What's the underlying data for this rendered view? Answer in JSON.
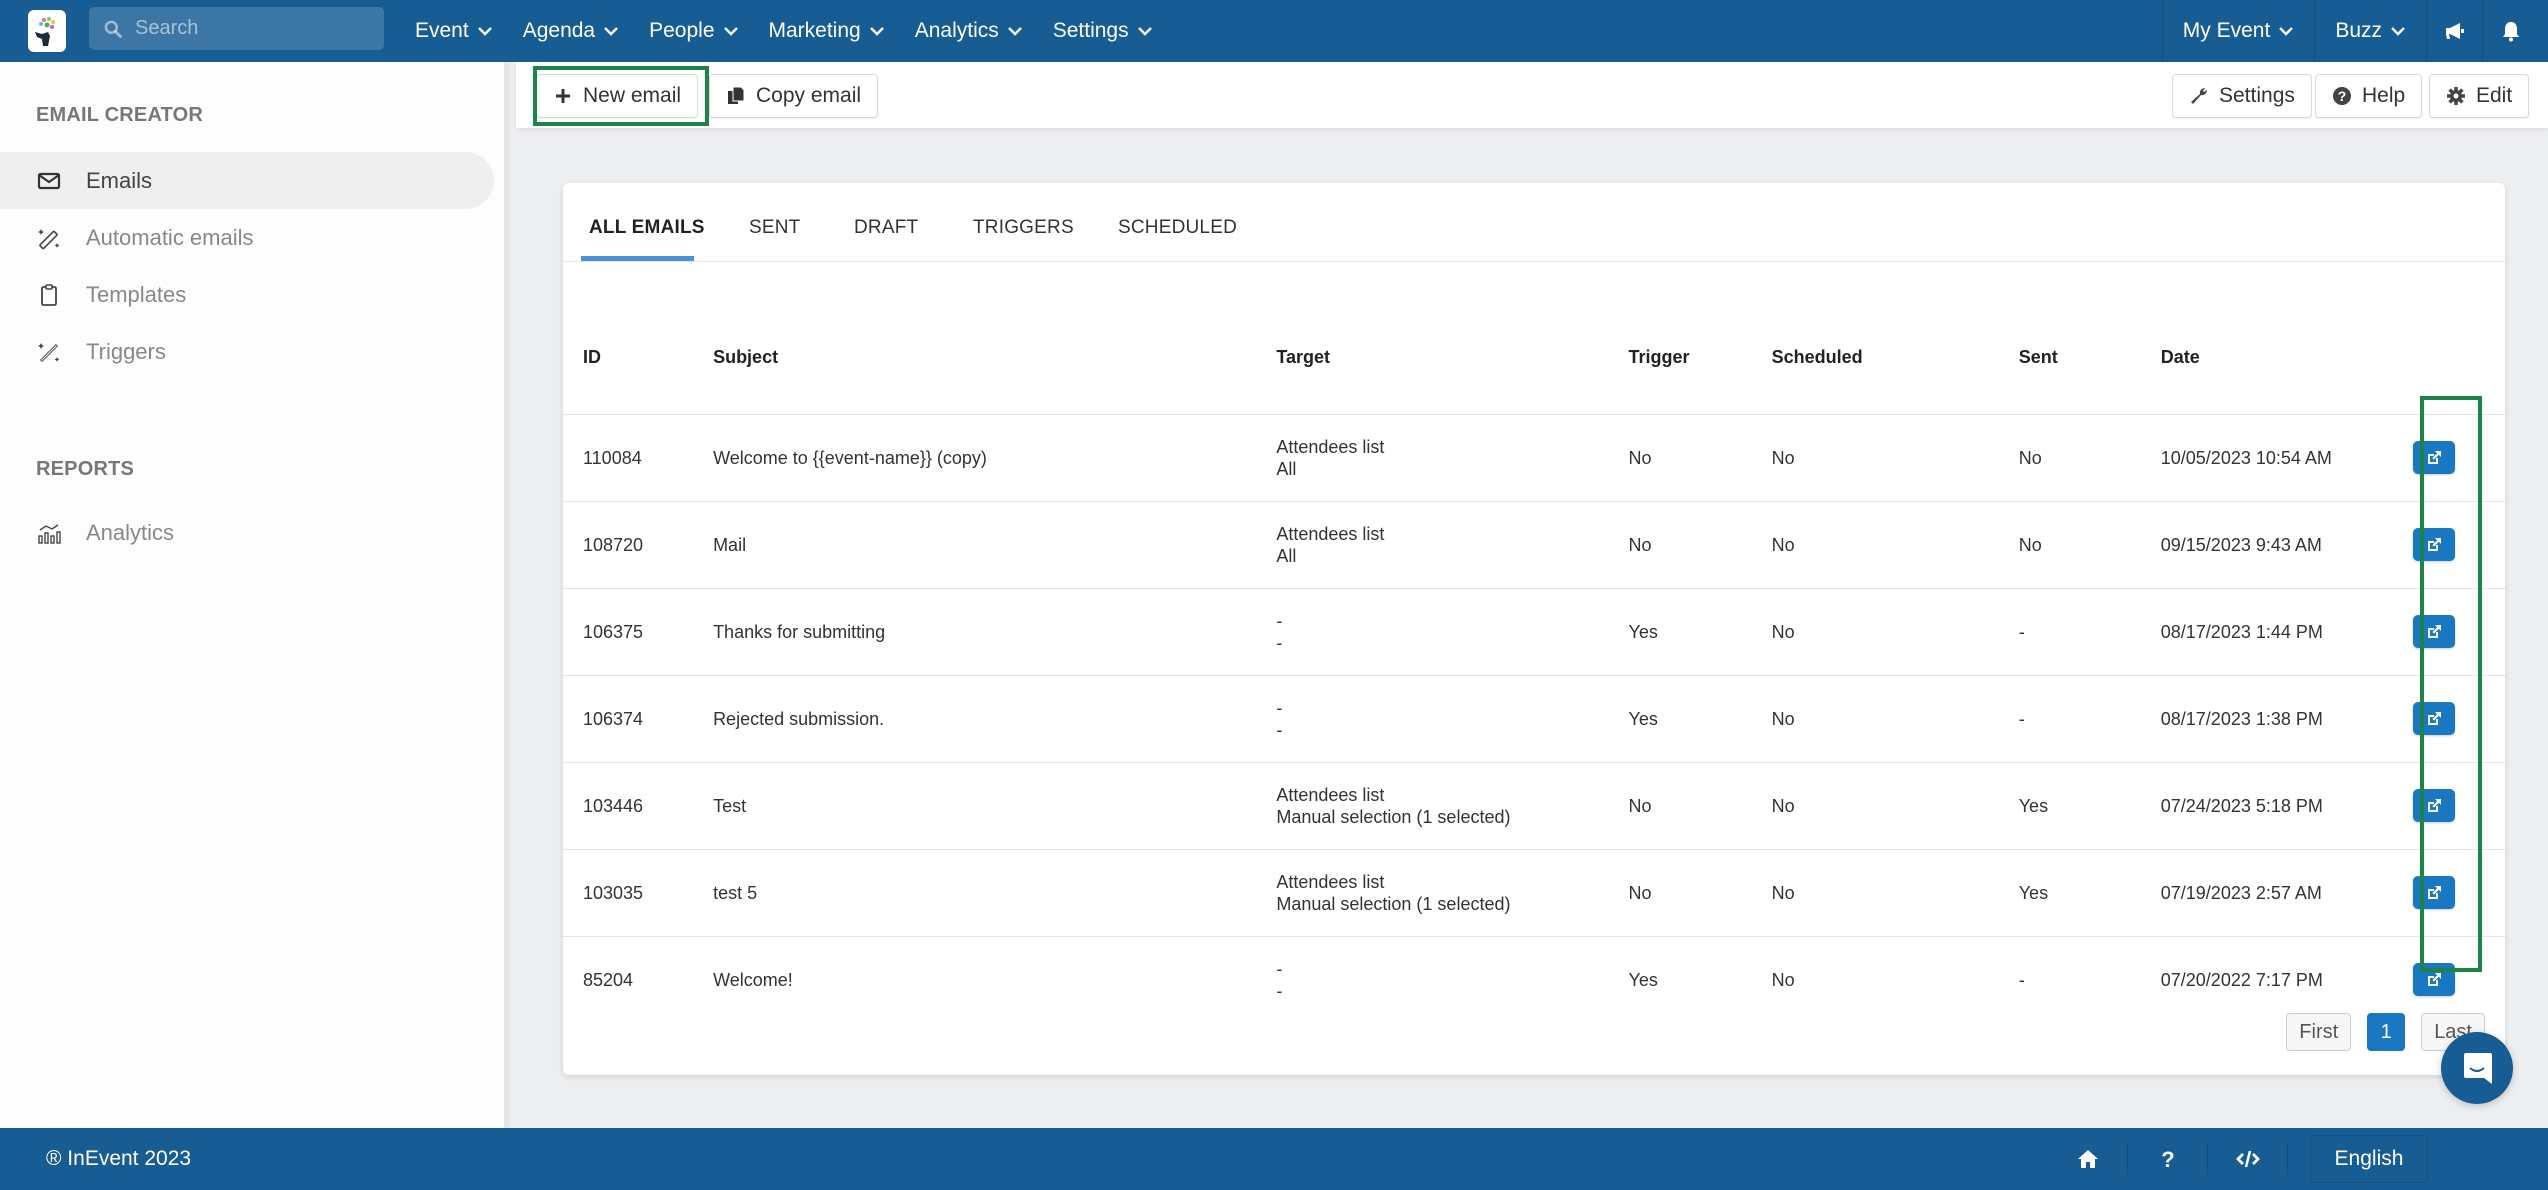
{
  "topbar": {
    "search_placeholder": "Search",
    "menu": [
      {
        "label": "Event"
      },
      {
        "label": "Agenda"
      },
      {
        "label": "People"
      },
      {
        "label": "Marketing"
      },
      {
        "label": "Analytics"
      },
      {
        "label": "Settings"
      }
    ],
    "right_menu": [
      {
        "label": "My Event"
      },
      {
        "label": "Buzz"
      }
    ],
    "icons": [
      "megaphone-icon",
      "bell-icon"
    ]
  },
  "sidebar": {
    "section1_title": "EMAIL CREATOR",
    "section1_items": [
      {
        "label": "Emails",
        "icon": "envelope-icon",
        "active": true
      },
      {
        "label": "Automatic emails",
        "icon": "magic-wand-icon",
        "active": false
      },
      {
        "label": "Templates",
        "icon": "clipboard-icon",
        "active": false
      },
      {
        "label": "Triggers",
        "icon": "magic-wand-icon",
        "active": false
      }
    ],
    "section2_title": "REPORTS",
    "section2_items": [
      {
        "label": "Analytics",
        "icon": "analytics-icon",
        "active": false
      }
    ]
  },
  "toolbar": {
    "new_email_label": "New email",
    "copy_email_label": "Copy email",
    "settings_label": "Settings",
    "help_label": "Help",
    "edit_label": "Edit"
  },
  "tabs": [
    {
      "label": "ALL EMAILS",
      "active": true
    },
    {
      "label": "SENT",
      "active": false
    },
    {
      "label": "DRAFT",
      "active": false
    },
    {
      "label": "TRIGGERS",
      "active": false
    },
    {
      "label": "SCHEDULED",
      "active": false
    }
  ],
  "table": {
    "columns": [
      "ID",
      "Subject",
      "Target",
      "Trigger",
      "Scheduled",
      "Sent",
      "Date"
    ],
    "rows": [
      {
        "id": "110084",
        "subject": "Welcome to {{event-name}} (copy)",
        "target_line1": "Attendees list",
        "target_line2": "All",
        "trigger": "No",
        "scheduled": "No",
        "sent": "No",
        "date": "10/05/2023 10:54 AM"
      },
      {
        "id": "108720",
        "subject": "Mail",
        "target_line1": "Attendees list",
        "target_line2": "All",
        "trigger": "No",
        "scheduled": "No",
        "sent": "No",
        "date": "09/15/2023 9:43 AM"
      },
      {
        "id": "106375",
        "subject": "Thanks for submitting",
        "target_line1": "-",
        "target_line2": "-",
        "trigger": "Yes",
        "scheduled": "No",
        "sent": "-",
        "date": "08/17/2023 1:44 PM"
      },
      {
        "id": "106374",
        "subject": "Rejected submission.",
        "target_line1": "-",
        "target_line2": "-",
        "trigger": "Yes",
        "scheduled": "No",
        "sent": "-",
        "date": "08/17/2023 1:38 PM"
      },
      {
        "id": "103446",
        "subject": "Test",
        "target_line1": "Attendees list",
        "target_line2": "Manual selection (1 selected)",
        "trigger": "No",
        "scheduled": "No",
        "sent": "Yes",
        "date": "07/24/2023 5:18 PM"
      },
      {
        "id": "103035",
        "subject": "test 5",
        "target_line1": "Attendees list",
        "target_line2": "Manual selection (1 selected)",
        "trigger": "No",
        "scheduled": "No",
        "sent": "Yes",
        "date": "07/19/2023 2:57 AM"
      },
      {
        "id": "85204",
        "subject": "Welcome!",
        "target_line1": "-",
        "target_line2": "-",
        "trigger": "Yes",
        "scheduled": "No",
        "sent": "-",
        "date": "07/20/2022 7:17 PM"
      }
    ]
  },
  "pagination": {
    "first_label": "First",
    "current_page": "1",
    "last_label": "Last"
  },
  "footer": {
    "copyright": "® InEvent 2023",
    "language": "English"
  },
  "colors": {
    "brand_blue": "#175c93",
    "action_blue": "#1a78c2",
    "highlight_green": "#1d8348",
    "tab_underline": "#4a90d9"
  }
}
